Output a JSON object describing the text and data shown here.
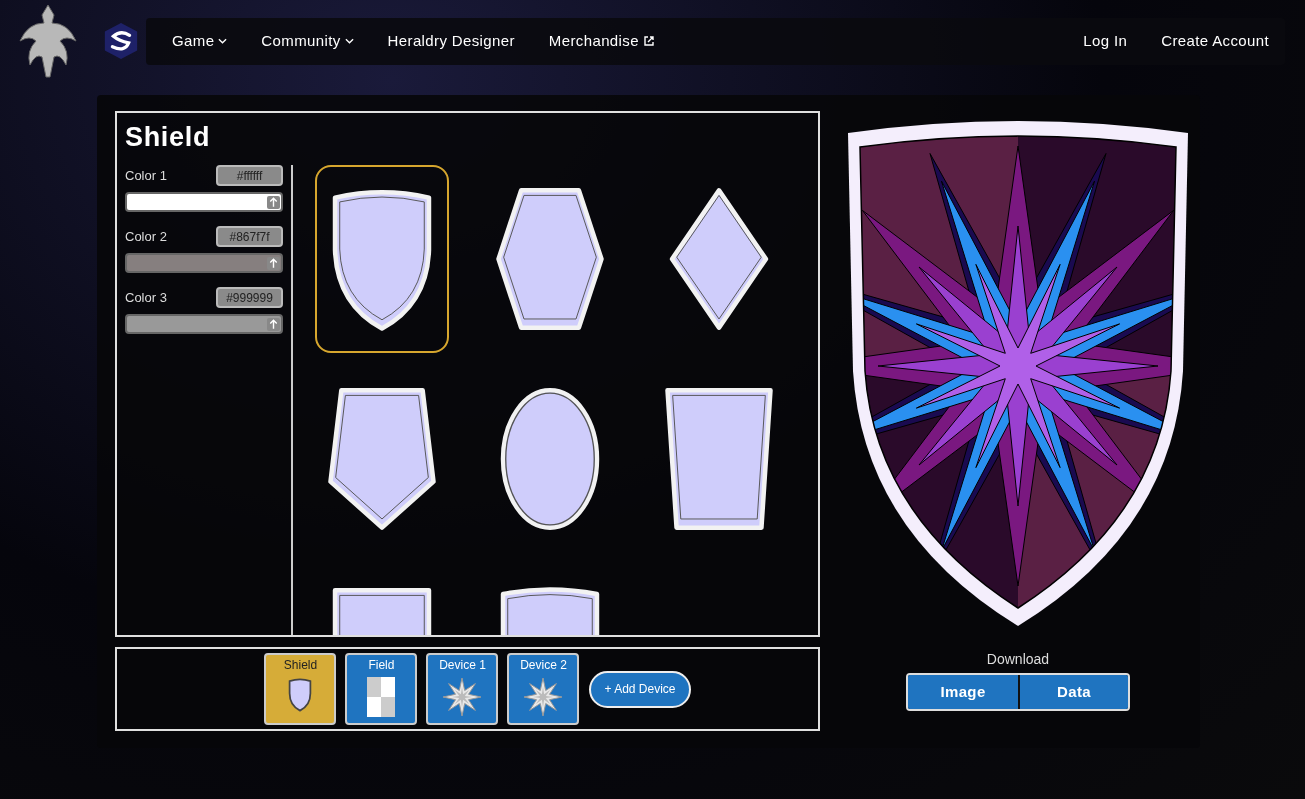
{
  "nav": {
    "items": [
      {
        "label": "Game",
        "kind": "dropdown"
      },
      {
        "label": "Community",
        "kind": "dropdown"
      },
      {
        "label": "Heraldry Designer",
        "kind": "link"
      },
      {
        "label": "Merchandise",
        "kind": "external"
      }
    ],
    "account": [
      "Log In",
      "Create Account"
    ]
  },
  "editor": {
    "title": "Shield",
    "colors": [
      {
        "label": "Color 1",
        "value": "#ffffff"
      },
      {
        "label": "Color 2",
        "value": "#867f7f"
      },
      {
        "label": "Color 3",
        "value": "#999999"
      }
    ],
    "shapes": [
      {
        "kind": "heater",
        "selected": true
      },
      {
        "kind": "hexagon",
        "selected": false
      },
      {
        "kind": "diamond",
        "selected": false
      },
      {
        "kind": "pentagon",
        "selected": false
      },
      {
        "kind": "oval",
        "selected": false
      },
      {
        "kind": "tapered",
        "selected": false
      },
      {
        "kind": "square",
        "selected": false
      },
      {
        "kind": "curved",
        "selected": false
      }
    ]
  },
  "layers": {
    "tabs": [
      {
        "label": "Shield",
        "kind": "shield",
        "selected": true
      },
      {
        "label": "Field",
        "kind": "field",
        "selected": false
      },
      {
        "label": "Device 1",
        "kind": "device",
        "selected": false
      },
      {
        "label": "Device 2",
        "kind": "device",
        "selected": false
      }
    ],
    "add_button": "+ Add Device"
  },
  "download": {
    "label": "Download",
    "buttons": [
      "Image",
      "Data"
    ]
  }
}
